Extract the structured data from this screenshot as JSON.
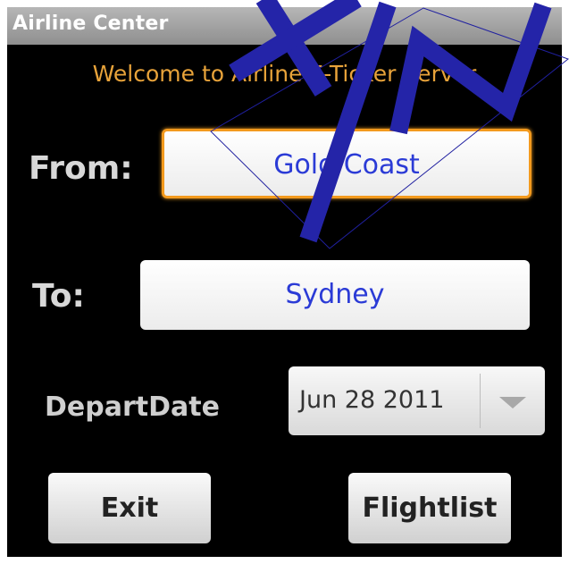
{
  "window": {
    "title": "Airline Center"
  },
  "welcome_text": "Welcome to Airline E-Ticker Server",
  "form": {
    "from_label": "From:",
    "from_value": "Gold Coast",
    "to_label": "To:",
    "to_value": "Sydney",
    "depart_label": "DepartDate",
    "depart_value": "Jun 28 2011"
  },
  "buttons": {
    "exit": "Exit",
    "flightlist": "Flightlist"
  },
  "watermark": {
    "text": "XIN",
    "color": "#2020a0"
  },
  "colors": {
    "accent": "#e8a33a",
    "field_text": "#2b3bd6",
    "focus_border": "#f39a1e"
  }
}
